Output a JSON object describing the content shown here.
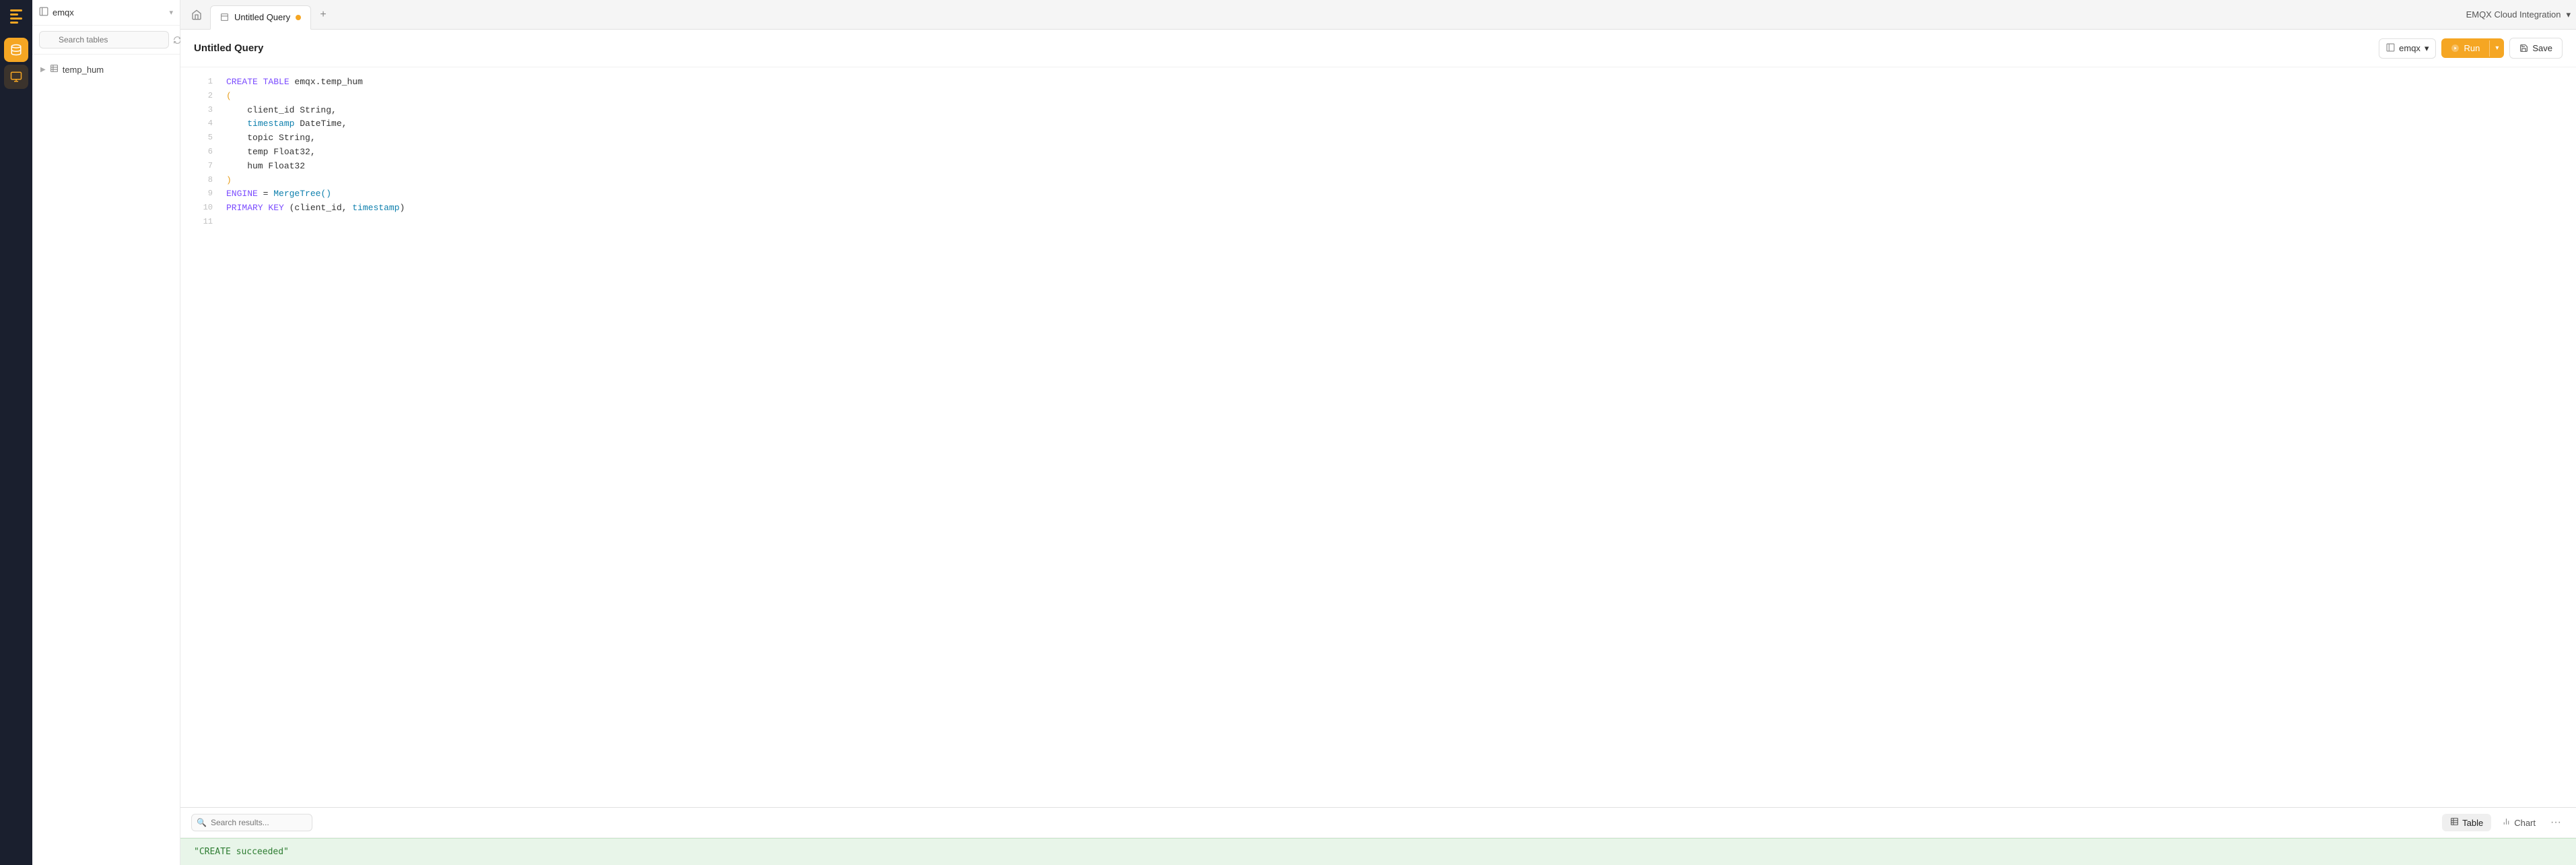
{
  "app": {
    "title": "EMQX Cloud Integration",
    "chevron": "▾"
  },
  "icon_bar": {
    "logo_label": "EMQX logo",
    "nav_items": [
      {
        "id": "database",
        "icon": "🗄",
        "active": true
      },
      {
        "id": "message",
        "icon": "✉",
        "active": false
      }
    ]
  },
  "sidebar": {
    "db_name": "emqx",
    "search_placeholder": "Search tables",
    "tables": [
      {
        "name": "temp_hum"
      }
    ]
  },
  "tab": {
    "label": "Untitled Query",
    "has_dot": true
  },
  "query": {
    "title": "Untitled Query",
    "db_selector_label": "emqx",
    "run_label": "Run",
    "save_label": "Save",
    "code_lines": [
      {
        "num": "1",
        "content": "CREATE TABLE emqx.temp_hum",
        "parts": [
          {
            "text": "CREATE TABLE ",
            "class": "kw"
          },
          {
            "text": "emqx.temp_hum",
            "class": ""
          }
        ]
      },
      {
        "num": "2",
        "content": "(",
        "parts": [
          {
            "text": "(",
            "class": ""
          }
        ]
      },
      {
        "num": "3",
        "content": "    client_id String,",
        "parts": [
          {
            "text": "    client_id String,",
            "class": ""
          }
        ]
      },
      {
        "num": "4",
        "content": "    timestamp DateTime,",
        "parts": [
          {
            "text": "    timestamp",
            "class": "kw2"
          },
          {
            "text": " DateTime,",
            "class": ""
          }
        ]
      },
      {
        "num": "5",
        "content": "    topic String,",
        "parts": [
          {
            "text": "    topic String,",
            "class": ""
          }
        ]
      },
      {
        "num": "6",
        "content": "    temp Float32,",
        "parts": [
          {
            "text": "    temp Float32,",
            "class": ""
          }
        ]
      },
      {
        "num": "7",
        "content": "    hum Float32",
        "parts": [
          {
            "text": "    hum Float32",
            "class": ""
          }
        ]
      },
      {
        "num": "8",
        "content": ")",
        "parts": [
          {
            "text": ")",
            "class": ""
          }
        ]
      },
      {
        "num": "9",
        "content": "ENGINE = MergeTree()",
        "parts": [
          {
            "text": "ENGINE",
            "class": "kw"
          },
          {
            "text": " = ",
            "class": ""
          },
          {
            "text": "MergeTree()",
            "class": "fn-call"
          }
        ]
      },
      {
        "num": "10",
        "content": "PRIMARY KEY (client_id, timestamp)",
        "parts": [
          {
            "text": "PRIMARY KEY",
            "class": "kw"
          },
          {
            "text": " (client_id, ",
            "class": ""
          },
          {
            "text": "timestamp",
            "class": "kw2"
          },
          {
            "text": ")",
            "class": ""
          }
        ]
      },
      {
        "num": "11",
        "content": "",
        "parts": []
      }
    ]
  },
  "results": {
    "search_placeholder": "Search results...",
    "table_tab_label": "Table",
    "chart_tab_label": "Chart",
    "active_view": "table",
    "success_message": "\"CREATE succeeded\""
  }
}
